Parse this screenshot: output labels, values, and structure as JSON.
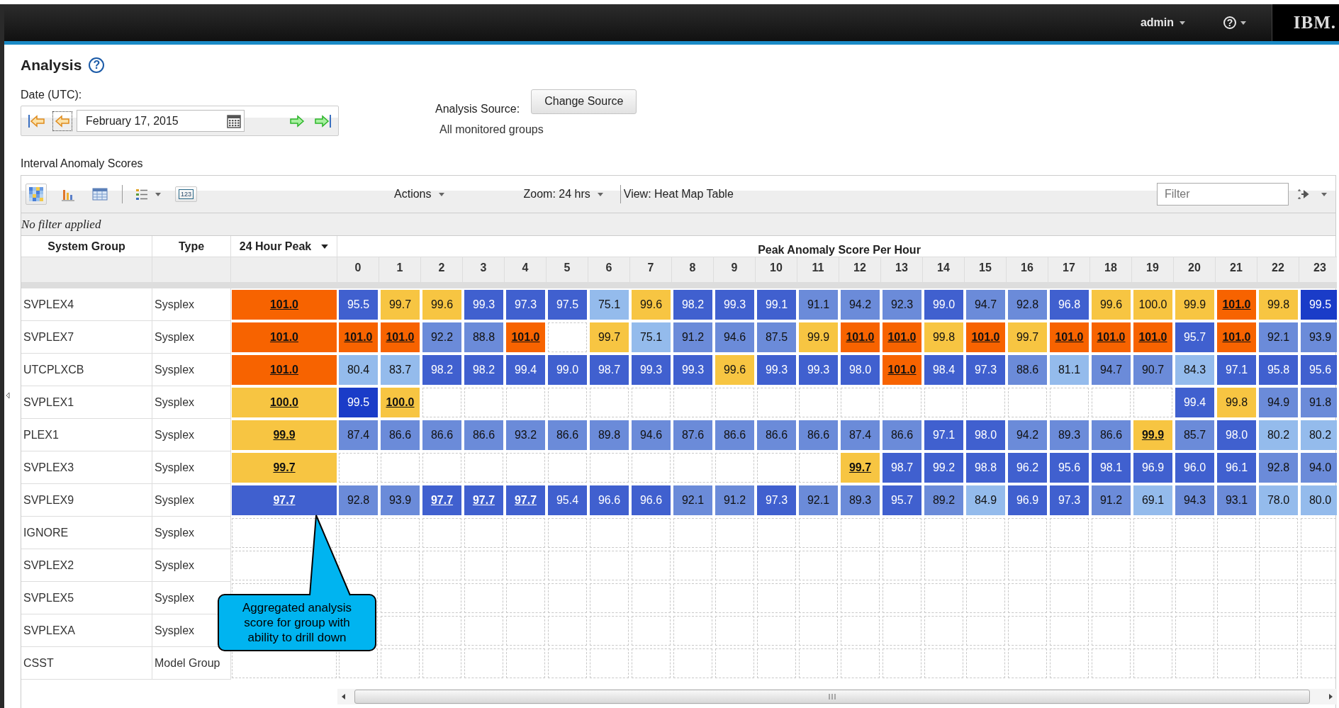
{
  "top_bar": {
    "user": "admin",
    "help": "?",
    "brand": "IBM."
  },
  "page": {
    "title": "Analysis",
    "help": "?"
  },
  "date": {
    "label": "Date (UTC):",
    "value": "February 17, 2015"
  },
  "source": {
    "label": "Analysis Source:",
    "button": "Change Source",
    "value": "All monitored groups"
  },
  "section_title": "Interval Anomaly Scores",
  "toolbar": {
    "views": [
      {
        "kind": "heatmap",
        "selected": true
      },
      {
        "kind": "bar",
        "selected": false
      },
      {
        "kind": "table",
        "selected": false
      }
    ],
    "number_button": "123",
    "actions": "Actions",
    "zoom": "Zoom: 24 hrs",
    "view": "View: Heat Map Table",
    "filter_placeholder": "Filter"
  },
  "filter_status": "No filter applied",
  "table": {
    "columns": [
      "System Group",
      "Type",
      "24 Hour Peak"
    ],
    "hours_title": "Peak Anomaly Score Per Hour",
    "hours": [
      "0",
      "1",
      "2",
      "3",
      "4",
      "5",
      "6",
      "7",
      "8",
      "9",
      "10",
      "11",
      "12",
      "13",
      "14",
      "15",
      "16",
      "17",
      "18",
      "19",
      "20",
      "21",
      "22",
      "23"
    ],
    "rows": [
      {
        "group": "SVPLEX4",
        "type": "Sysplex",
        "peak": {
          "value": "101.0",
          "color": "#f76300",
          "link": true
        },
        "hours": [
          {
            "kind": "score",
            "value": "95.5",
            "color": "#4060cf",
            "link": false
          },
          {
            "kind": "score",
            "value": "99.7",
            "color": "#f7c542",
            "link": false
          },
          {
            "kind": "score",
            "value": "99.6",
            "color": "#f7c542",
            "link": false
          },
          {
            "kind": "score",
            "value": "99.3",
            "color": "#4060cf",
            "link": false
          },
          {
            "kind": "score",
            "value": "97.3",
            "color": "#4060cf",
            "link": false
          },
          {
            "kind": "score",
            "value": "97.5",
            "color": "#4060cf",
            "link": false
          },
          {
            "kind": "score",
            "value": "75.1",
            "color": "#94bbec",
            "link": false
          },
          {
            "kind": "score",
            "value": "99.6",
            "color": "#f7c542",
            "link": false
          },
          {
            "kind": "score",
            "value": "98.2",
            "color": "#4060cf",
            "link": false
          },
          {
            "kind": "score",
            "value": "99.3",
            "color": "#4060cf",
            "link": false
          },
          {
            "kind": "score",
            "value": "99.1",
            "color": "#4060cf",
            "link": false
          },
          {
            "kind": "score",
            "value": "91.1",
            "color": "#6b8bd9",
            "link": false
          },
          {
            "kind": "score",
            "value": "94.2",
            "color": "#6b8bd9",
            "link": false
          },
          {
            "kind": "score",
            "value": "92.3",
            "color": "#6b8bd9",
            "link": false
          },
          {
            "kind": "score",
            "value": "99.0",
            "color": "#4060cf",
            "link": false
          },
          {
            "kind": "score",
            "value": "94.7",
            "color": "#6b8bd9",
            "link": false
          },
          {
            "kind": "score",
            "value": "92.8",
            "color": "#6b8bd9",
            "link": false
          },
          {
            "kind": "score",
            "value": "96.8",
            "color": "#4060cf",
            "link": false
          },
          {
            "kind": "score",
            "value": "99.6",
            "color": "#f7c542",
            "link": false
          },
          {
            "kind": "score",
            "value": "100.0",
            "color": "#f7c542",
            "link": false
          },
          {
            "kind": "score",
            "value": "99.9",
            "color": "#f7c542",
            "link": false
          },
          {
            "kind": "score",
            "value": "101.0",
            "color": "#f76300",
            "link": true
          },
          {
            "kind": "score",
            "value": "99.8",
            "color": "#f7c542",
            "link": false
          },
          {
            "kind": "score",
            "value": "99.5",
            "color": "#1a3cc8",
            "link": false
          }
        ]
      },
      {
        "group": "SVPLEX7",
        "type": "Sysplex",
        "peak": {
          "value": "101.0",
          "color": "#f76300",
          "link": true
        },
        "hours": [
          {
            "kind": "score",
            "value": "101.0",
            "color": "#f76300",
            "link": true
          },
          {
            "kind": "score",
            "value": "101.0",
            "color": "#f76300",
            "link": true
          },
          {
            "kind": "score",
            "value": "92.2",
            "color": "#6b8bd9",
            "link": false
          },
          {
            "kind": "score",
            "value": "88.8",
            "color": "#6b8bd9",
            "link": false
          },
          {
            "kind": "score",
            "value": "101.0",
            "color": "#f76300",
            "link": true
          },
          {
            "kind": "empty"
          },
          {
            "kind": "score",
            "value": "99.7",
            "color": "#f7c542",
            "link": false
          },
          {
            "kind": "score",
            "value": "75.1",
            "color": "#94bbec",
            "link": false
          },
          {
            "kind": "score",
            "value": "91.2",
            "color": "#6b8bd9",
            "link": false
          },
          {
            "kind": "score",
            "value": "94.6",
            "color": "#6b8bd9",
            "link": false
          },
          {
            "kind": "score",
            "value": "87.5",
            "color": "#6b8bd9",
            "link": false
          },
          {
            "kind": "score",
            "value": "99.9",
            "color": "#f7c542",
            "link": false
          },
          {
            "kind": "score",
            "value": "101.0",
            "color": "#f76300",
            "link": true
          },
          {
            "kind": "score",
            "value": "101.0",
            "color": "#f76300",
            "link": true
          },
          {
            "kind": "score",
            "value": "99.8",
            "color": "#f7c542",
            "link": false
          },
          {
            "kind": "score",
            "value": "101.0",
            "color": "#f76300",
            "link": true
          },
          {
            "kind": "score",
            "value": "99.7",
            "color": "#f7c542",
            "link": false
          },
          {
            "kind": "score",
            "value": "101.0",
            "color": "#f76300",
            "link": true
          },
          {
            "kind": "score",
            "value": "101.0",
            "color": "#f76300",
            "link": true
          },
          {
            "kind": "score",
            "value": "101.0",
            "color": "#f76300",
            "link": true
          },
          {
            "kind": "score",
            "value": "95.7",
            "color": "#4060cf",
            "link": false
          },
          {
            "kind": "score",
            "value": "101.0",
            "color": "#f76300",
            "link": true
          },
          {
            "kind": "score",
            "value": "92.1",
            "color": "#6b8bd9",
            "link": false
          },
          {
            "kind": "score",
            "value": "93.9",
            "color": "#6b8bd9",
            "link": false
          }
        ]
      },
      {
        "group": "UTCPLXCB",
        "type": "Sysplex",
        "peak": {
          "value": "101.0",
          "color": "#f76300",
          "link": true
        },
        "hours": [
          {
            "kind": "score",
            "value": "80.4",
            "color": "#94bbec",
            "link": false
          },
          {
            "kind": "score",
            "value": "83.7",
            "color": "#94bbec",
            "link": false
          },
          {
            "kind": "score",
            "value": "98.2",
            "color": "#4060cf",
            "link": false
          },
          {
            "kind": "score",
            "value": "98.2",
            "color": "#4060cf",
            "link": false
          },
          {
            "kind": "score",
            "value": "99.4",
            "color": "#4060cf",
            "link": false
          },
          {
            "kind": "score",
            "value": "99.0",
            "color": "#4060cf",
            "link": false
          },
          {
            "kind": "score",
            "value": "98.7",
            "color": "#4060cf",
            "link": false
          },
          {
            "kind": "score",
            "value": "99.3",
            "color": "#4060cf",
            "link": false
          },
          {
            "kind": "score",
            "value": "99.3",
            "color": "#4060cf",
            "link": false
          },
          {
            "kind": "score",
            "value": "99.6",
            "color": "#f7c542",
            "link": false
          },
          {
            "kind": "score",
            "value": "99.3",
            "color": "#4060cf",
            "link": false
          },
          {
            "kind": "score",
            "value": "99.3",
            "color": "#4060cf",
            "link": false
          },
          {
            "kind": "score",
            "value": "98.0",
            "color": "#4060cf",
            "link": false
          },
          {
            "kind": "score",
            "value": "101.0",
            "color": "#f76300",
            "link": true
          },
          {
            "kind": "score",
            "value": "98.4",
            "color": "#4060cf",
            "link": false
          },
          {
            "kind": "score",
            "value": "97.3",
            "color": "#4060cf",
            "link": false
          },
          {
            "kind": "score",
            "value": "88.6",
            "color": "#6b8bd9",
            "link": false
          },
          {
            "kind": "score",
            "value": "81.1",
            "color": "#94bbec",
            "link": false
          },
          {
            "kind": "score",
            "value": "94.7",
            "color": "#6b8bd9",
            "link": false
          },
          {
            "kind": "score",
            "value": "90.7",
            "color": "#6b8bd9",
            "link": false
          },
          {
            "kind": "score",
            "value": "84.3",
            "color": "#94bbec",
            "link": false
          },
          {
            "kind": "score",
            "value": "97.1",
            "color": "#4060cf",
            "link": false
          },
          {
            "kind": "score",
            "value": "95.8",
            "color": "#4060cf",
            "link": false
          },
          {
            "kind": "score",
            "value": "95.6",
            "color": "#4060cf",
            "link": false
          }
        ]
      },
      {
        "group": "SVPLEX1",
        "type": "Sysplex",
        "peak": {
          "value": "100.0",
          "color": "#f7c542",
          "link": true
        },
        "hours": [
          {
            "kind": "score",
            "value": "99.5",
            "color": "#1a3cc8",
            "link": false
          },
          {
            "kind": "score",
            "value": "100.0",
            "color": "#f7c542",
            "link": true
          },
          {
            "kind": "empty"
          },
          {
            "kind": "empty"
          },
          {
            "kind": "empty"
          },
          {
            "kind": "empty"
          },
          {
            "kind": "empty"
          },
          {
            "kind": "empty"
          },
          {
            "kind": "empty"
          },
          {
            "kind": "empty"
          },
          {
            "kind": "empty"
          },
          {
            "kind": "empty"
          },
          {
            "kind": "empty"
          },
          {
            "kind": "empty"
          },
          {
            "kind": "empty"
          },
          {
            "kind": "empty"
          },
          {
            "kind": "empty"
          },
          {
            "kind": "empty"
          },
          {
            "kind": "empty"
          },
          {
            "kind": "empty"
          },
          {
            "kind": "score",
            "value": "99.4",
            "color": "#4060cf",
            "link": false
          },
          {
            "kind": "score",
            "value": "99.8",
            "color": "#f7c542",
            "link": false
          },
          {
            "kind": "score",
            "value": "94.9",
            "color": "#6b8bd9",
            "link": false
          },
          {
            "kind": "score",
            "value": "91.8",
            "color": "#6b8bd9",
            "link": false
          }
        ]
      },
      {
        "group": "PLEX1",
        "type": "Sysplex",
        "peak": {
          "value": "99.9",
          "color": "#f7c542",
          "link": true
        },
        "hours": [
          {
            "kind": "score",
            "value": "87.4",
            "color": "#6b8bd9",
            "link": false
          },
          {
            "kind": "score",
            "value": "86.6",
            "color": "#6b8bd9",
            "link": false
          },
          {
            "kind": "score",
            "value": "86.6",
            "color": "#6b8bd9",
            "link": false
          },
          {
            "kind": "score",
            "value": "86.6",
            "color": "#6b8bd9",
            "link": false
          },
          {
            "kind": "score",
            "value": "93.2",
            "color": "#6b8bd9",
            "link": false
          },
          {
            "kind": "score",
            "value": "86.6",
            "color": "#6b8bd9",
            "link": false
          },
          {
            "kind": "score",
            "value": "89.8",
            "color": "#6b8bd9",
            "link": false
          },
          {
            "kind": "score",
            "value": "94.6",
            "color": "#6b8bd9",
            "link": false
          },
          {
            "kind": "score",
            "value": "87.6",
            "color": "#6b8bd9",
            "link": false
          },
          {
            "kind": "score",
            "value": "86.6",
            "color": "#6b8bd9",
            "link": false
          },
          {
            "kind": "score",
            "value": "86.6",
            "color": "#6b8bd9",
            "link": false
          },
          {
            "kind": "score",
            "value": "86.6",
            "color": "#6b8bd9",
            "link": false
          },
          {
            "kind": "score",
            "value": "87.4",
            "color": "#6b8bd9",
            "link": false
          },
          {
            "kind": "score",
            "value": "86.6",
            "color": "#6b8bd9",
            "link": false
          },
          {
            "kind": "score",
            "value": "97.1",
            "color": "#4060cf",
            "link": false
          },
          {
            "kind": "score",
            "value": "98.0",
            "color": "#4060cf",
            "link": false
          },
          {
            "kind": "score",
            "value": "94.2",
            "color": "#6b8bd9",
            "link": false
          },
          {
            "kind": "score",
            "value": "89.3",
            "color": "#6b8bd9",
            "link": false
          },
          {
            "kind": "score",
            "value": "86.6",
            "color": "#6b8bd9",
            "link": false
          },
          {
            "kind": "score",
            "value": "99.9",
            "color": "#f7c542",
            "link": true
          },
          {
            "kind": "score",
            "value": "85.7",
            "color": "#6b8bd9",
            "link": false
          },
          {
            "kind": "score",
            "value": "98.0",
            "color": "#4060cf",
            "link": false
          },
          {
            "kind": "score",
            "value": "80.2",
            "color": "#94bbec",
            "link": false
          },
          {
            "kind": "score",
            "value": "80.2",
            "color": "#94bbec",
            "link": false
          }
        ]
      },
      {
        "group": "SVPLEX3",
        "type": "Sysplex",
        "peak": {
          "value": "99.7",
          "color": "#f7c542",
          "link": true
        },
        "hours": [
          {
            "kind": "empty"
          },
          {
            "kind": "empty"
          },
          {
            "kind": "empty"
          },
          {
            "kind": "empty"
          },
          {
            "kind": "empty"
          },
          {
            "kind": "empty"
          },
          {
            "kind": "empty"
          },
          {
            "kind": "empty"
          },
          {
            "kind": "empty"
          },
          {
            "kind": "empty"
          },
          {
            "kind": "empty"
          },
          {
            "kind": "empty"
          },
          {
            "kind": "score",
            "value": "99.7",
            "color": "#f7c542",
            "link": true
          },
          {
            "kind": "score",
            "value": "98.7",
            "color": "#4060cf",
            "link": false
          },
          {
            "kind": "score",
            "value": "99.2",
            "color": "#4060cf",
            "link": false
          },
          {
            "kind": "score",
            "value": "98.8",
            "color": "#4060cf",
            "link": false
          },
          {
            "kind": "score",
            "value": "96.2",
            "color": "#4060cf",
            "link": false
          },
          {
            "kind": "score",
            "value": "95.6",
            "color": "#4060cf",
            "link": false
          },
          {
            "kind": "score",
            "value": "98.1",
            "color": "#4060cf",
            "link": false
          },
          {
            "kind": "score",
            "value": "96.9",
            "color": "#4060cf",
            "link": false
          },
          {
            "kind": "score",
            "value": "96.0",
            "color": "#4060cf",
            "link": false
          },
          {
            "kind": "score",
            "value": "96.1",
            "color": "#4060cf",
            "link": false
          },
          {
            "kind": "score",
            "value": "92.8",
            "color": "#6b8bd9",
            "link": false
          },
          {
            "kind": "score",
            "value": "94.0",
            "color": "#6b8bd9",
            "link": false
          }
        ]
      },
      {
        "group": "SVPLEX9",
        "type": "Sysplex",
        "peak": {
          "value": "97.7",
          "color": "#4060cf",
          "link": true
        },
        "hours": [
          {
            "kind": "score",
            "value": "92.8",
            "color": "#6b8bd9",
            "link": false
          },
          {
            "kind": "score",
            "value": "93.9",
            "color": "#6b8bd9",
            "link": false
          },
          {
            "kind": "score",
            "value": "97.7",
            "color": "#4060cf",
            "link": true
          },
          {
            "kind": "score",
            "value": "97.7",
            "color": "#4060cf",
            "link": true
          },
          {
            "kind": "score",
            "value": "97.7",
            "color": "#4060cf",
            "link": true
          },
          {
            "kind": "score",
            "value": "95.4",
            "color": "#4060cf",
            "link": false
          },
          {
            "kind": "score",
            "value": "96.6",
            "color": "#4060cf",
            "link": false
          },
          {
            "kind": "score",
            "value": "96.6",
            "color": "#4060cf",
            "link": false
          },
          {
            "kind": "score",
            "value": "92.1",
            "color": "#6b8bd9",
            "link": false
          },
          {
            "kind": "score",
            "value": "91.2",
            "color": "#6b8bd9",
            "link": false
          },
          {
            "kind": "score",
            "value": "97.3",
            "color": "#4060cf",
            "link": false
          },
          {
            "kind": "score",
            "value": "92.1",
            "color": "#6b8bd9",
            "link": false
          },
          {
            "kind": "score",
            "value": "89.3",
            "color": "#6b8bd9",
            "link": false
          },
          {
            "kind": "score",
            "value": "95.7",
            "color": "#4060cf",
            "link": false
          },
          {
            "kind": "score",
            "value": "89.2",
            "color": "#6b8bd9",
            "link": false
          },
          {
            "kind": "score",
            "value": "84.9",
            "color": "#94bbec",
            "link": false
          },
          {
            "kind": "score",
            "value": "96.9",
            "color": "#4060cf",
            "link": false
          },
          {
            "kind": "score",
            "value": "97.3",
            "color": "#4060cf",
            "link": false
          },
          {
            "kind": "score",
            "value": "91.2",
            "color": "#6b8bd9",
            "link": false
          },
          {
            "kind": "score",
            "value": "69.1",
            "color": "#94bbec",
            "link": false
          },
          {
            "kind": "score",
            "value": "94.3",
            "color": "#6b8bd9",
            "link": false
          },
          {
            "kind": "score",
            "value": "93.1",
            "color": "#6b8bd9",
            "link": false
          },
          {
            "kind": "score",
            "value": "78.0",
            "color": "#94bbec",
            "link": false
          },
          {
            "kind": "score",
            "value": "80.0",
            "color": "#94bbec",
            "link": false
          }
        ]
      },
      {
        "group": "IGNORE",
        "type": "Sysplex"
      },
      {
        "group": "SVPLEX2",
        "type": "Sysplex"
      },
      {
        "group": "SVPLEX5",
        "type": "Sysplex"
      },
      {
        "group": "SVPLEXA",
        "type": "Sysplex"
      },
      {
        "group": "CSST",
        "type": "Model Group"
      }
    ]
  },
  "callout": "Aggregated analysis score for group with ability to drill down"
}
